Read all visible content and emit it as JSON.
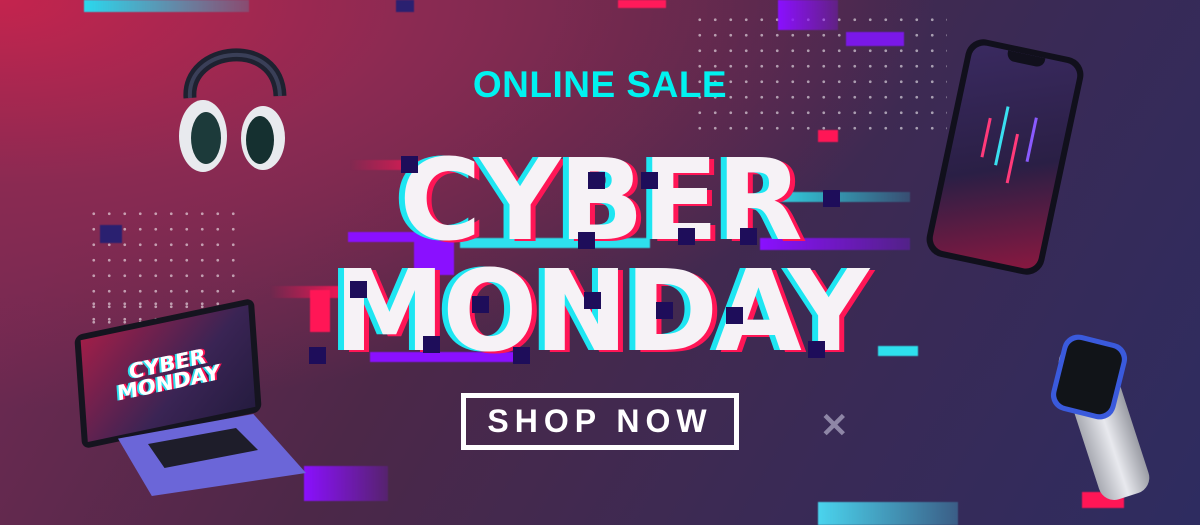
{
  "banner": {
    "eyebrow": "ONLINE SALE",
    "headline_line1": "CYBER",
    "headline_line2": "MONDAY",
    "cta_label": "SHOP NOW",
    "laptop_screen_line1": "CYBER",
    "laptop_screen_line2": "MONDAY",
    "colors": {
      "cyan": "#00f2f0",
      "magenta": "#ff1656",
      "purple": "#8a10ff",
      "navy": "#1e0d5a"
    }
  }
}
